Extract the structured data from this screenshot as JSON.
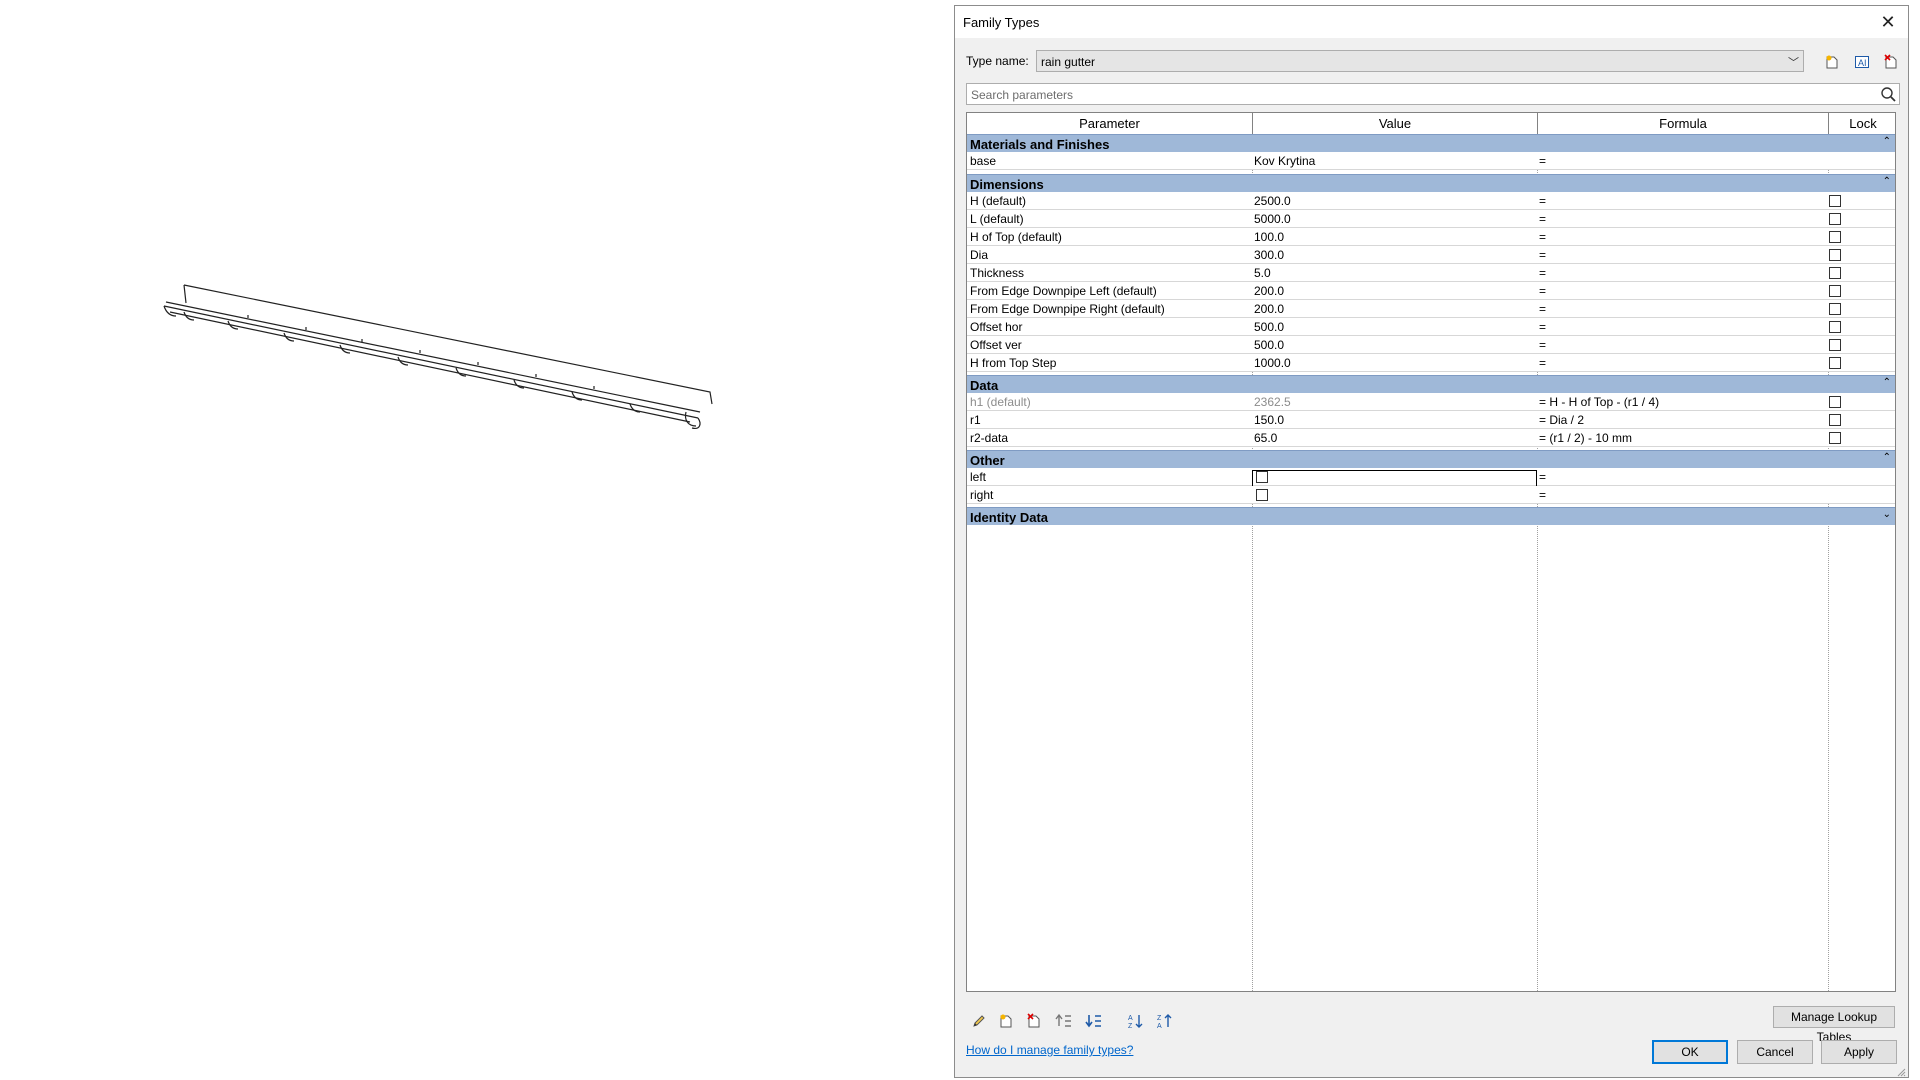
{
  "dialog": {
    "title": "Family Types",
    "close_icon": "close-icon",
    "type_name_label": "Type name:",
    "type_name_value": "rain gutter",
    "search_placeholder": "Search parameters",
    "columns": [
      "Parameter",
      "Value",
      "Formula",
      "Lock"
    ],
    "groups": [
      {
        "name": "Materials and Finishes",
        "collapse_icon": "collapse-up-icon",
        "rows": [
          {
            "parameter": "base",
            "value": "Kov Krytina",
            "formula": "=",
            "lock": null
          }
        ]
      },
      {
        "name": "Dimensions",
        "collapse_icon": "collapse-up-icon",
        "rows": [
          {
            "parameter": "H (default)",
            "value": "2500.0",
            "formula": "=",
            "lock": false
          },
          {
            "parameter": "L (default)",
            "value": "5000.0",
            "formula": "=",
            "lock": false
          },
          {
            "parameter": "H of Top (default)",
            "value": "100.0",
            "formula": "=",
            "lock": false
          },
          {
            "parameter": "Dia",
            "value": "300.0",
            "formula": "=",
            "lock": false
          },
          {
            "parameter": "Thickness",
            "value": "5.0",
            "formula": "=",
            "lock": false
          },
          {
            "parameter": "From Edge Downpipe Left (default)",
            "value": "200.0",
            "formula": "=",
            "lock": false
          },
          {
            "parameter": "From Edge Downpipe Right (default)",
            "value": "200.0",
            "formula": "=",
            "lock": false
          },
          {
            "parameter": "Offset hor",
            "value": "500.0",
            "formula": "=",
            "lock": false
          },
          {
            "parameter": "Offset ver",
            "value": "500.0",
            "formula": "=",
            "lock": false
          },
          {
            "parameter": "H from Top Step",
            "value": "1000.0",
            "formula": "=",
            "lock": false
          }
        ]
      },
      {
        "name": "Data",
        "collapse_icon": "collapse-up-icon",
        "rows": [
          {
            "parameter": "h1 (default)",
            "value": "2362.5",
            "formula": "= H - H of Top - (r1 / 4)",
            "lock": false,
            "muted": true
          },
          {
            "parameter": "r1",
            "value": "150.0",
            "formula": "= Dia / 2",
            "lock": false
          },
          {
            "parameter": "r2-data",
            "value": "65.0",
            "formula": "= (r1 / 2) - 10 mm",
            "lock": false
          }
        ]
      },
      {
        "name": "Other",
        "collapse_icon": "collapse-up-icon",
        "rows": [
          {
            "parameter": "left",
            "value_checkbox": false,
            "formula": "=",
            "lock": null,
            "selected": true
          },
          {
            "parameter": "right",
            "value_checkbox": false,
            "formula": "=",
            "lock": null
          }
        ]
      },
      {
        "name": "Identity Data",
        "collapse_icon": "expand-down-icon",
        "rows": []
      }
    ],
    "toolbar_icons": [
      "edit-parameter-icon",
      "new-parameter-icon",
      "delete-parameter-icon",
      "move-up-icon",
      "move-down-icon",
      "sort-ascending-icon",
      "sort-descending-icon"
    ],
    "manage_lookup_tables": "Manage Lookup Tables",
    "help_link": "How do I manage family types?",
    "ok": "OK",
    "cancel": "Cancel",
    "apply": "Apply"
  },
  "colors": {
    "group_header": "#9fb8d8",
    "accent": "#0078d7",
    "link": "#0066cc"
  }
}
